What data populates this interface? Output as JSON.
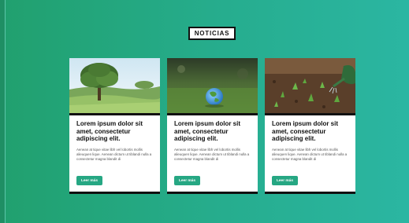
{
  "section": {
    "title": "NOTICIAS"
  },
  "cards": [
    {
      "image": "tree-landscape-photo",
      "title": "Lorem ipsum dolor sit amet, consectetur adipiscing elit.",
      "text": "Aenean at tique vitae libh vel lobortis mollis alieuquen lique. Aenean dictum ut tiblandi nulla a consectetur magna blandit di",
      "button": "Leer más"
    },
    {
      "image": "globe-on-grass-photo",
      "title": "Lorem ipsum dolor sit amet, consectetur adipiscing elit.",
      "text": "Aenean at tique vitae libh vel lobortis mollis alieuquen lique. Aenean dictum ut tiblandi nulla a consectetur magna blandit di",
      "button": "Leer más"
    },
    {
      "image": "watering-seedlings-photo",
      "title": "Lorem ipsum dolor sit amet, consectetur adipiscing elit.",
      "text": "Aenean at tique vitae libh vel lobortis mollis alieuquen lique. Aenean dictum ut tiblandi nulla a consectetur magna blandit di",
      "button": "Leer más"
    }
  ],
  "colors": {
    "accent": "#26a783",
    "background": "#21a06e",
    "border": "#111111"
  }
}
